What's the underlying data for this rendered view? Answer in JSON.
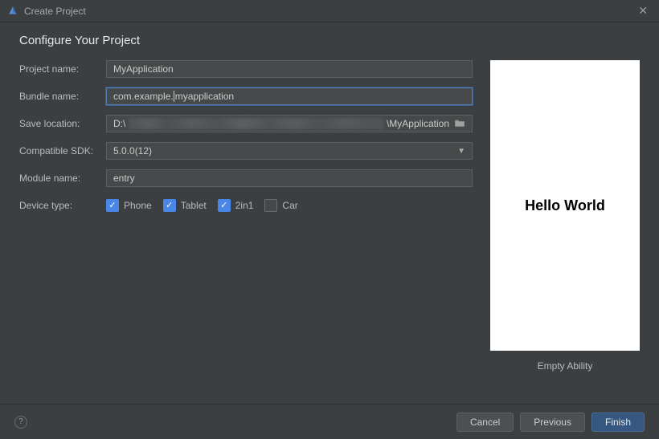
{
  "titlebar": {
    "title": "Create Project"
  },
  "heading": "Configure Your Project",
  "labels": {
    "project_name": "Project name:",
    "bundle_name": "Bundle name:",
    "save_location": "Save location:",
    "compatible_sdk": "Compatible SDK:",
    "module_name": "Module name:",
    "device_type": "Device type:"
  },
  "fields": {
    "project_name": "MyApplication",
    "bundle_name_pre": "com.example",
    "bundle_name_post": "myapplication",
    "save_location_prefix": "D:\\",
    "save_location_suffix": "\\MyApplication",
    "compatible_sdk": "5.0.0(12)",
    "module_name": "entry"
  },
  "devices": {
    "phone": {
      "label": "Phone",
      "checked": true
    },
    "tablet": {
      "label": "Tablet",
      "checked": true
    },
    "two_in_one": {
      "label": "2in1",
      "checked": true
    },
    "car": {
      "label": "Car",
      "checked": false
    }
  },
  "preview": {
    "text": "Hello World",
    "caption": "Empty Ability"
  },
  "footer": {
    "cancel": "Cancel",
    "previous": "Previous",
    "finish": "Finish"
  }
}
